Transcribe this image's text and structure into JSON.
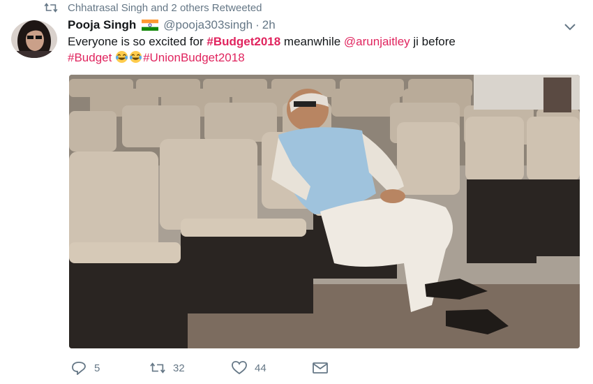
{
  "social_context": {
    "text": "Chhatrasal Singh and 2 others Retweeted"
  },
  "author": {
    "name": "Pooja Singh",
    "handle": "@pooja303singh",
    "separator": "·",
    "time": "2h"
  },
  "tweet": {
    "segments": [
      {
        "text": "Everyone is so excited for "
      },
      {
        "text": "#Budget2018",
        "kind": "hashtag-bold"
      },
      {
        "text": " meanwhile "
      },
      {
        "text": "@arunjaitley",
        "kind": "mention"
      },
      {
        "text": " ji before"
      },
      {
        "text": "#Budget",
        "kind": "hashtag"
      },
      {
        "text": "#UnionBudget2018",
        "kind": "hashtag"
      }
    ]
  },
  "actions": {
    "replies": "5",
    "retweets": "32",
    "likes": "44"
  },
  "colors": {
    "accent": "#e0245e",
    "muted": "#657786",
    "text": "#14171a"
  },
  "icons": [
    "retweet-icon",
    "india-flag-icon",
    "chevron-down-icon",
    "laughing-emoji-icon",
    "reply-icon",
    "heart-icon",
    "envelope-icon"
  ]
}
